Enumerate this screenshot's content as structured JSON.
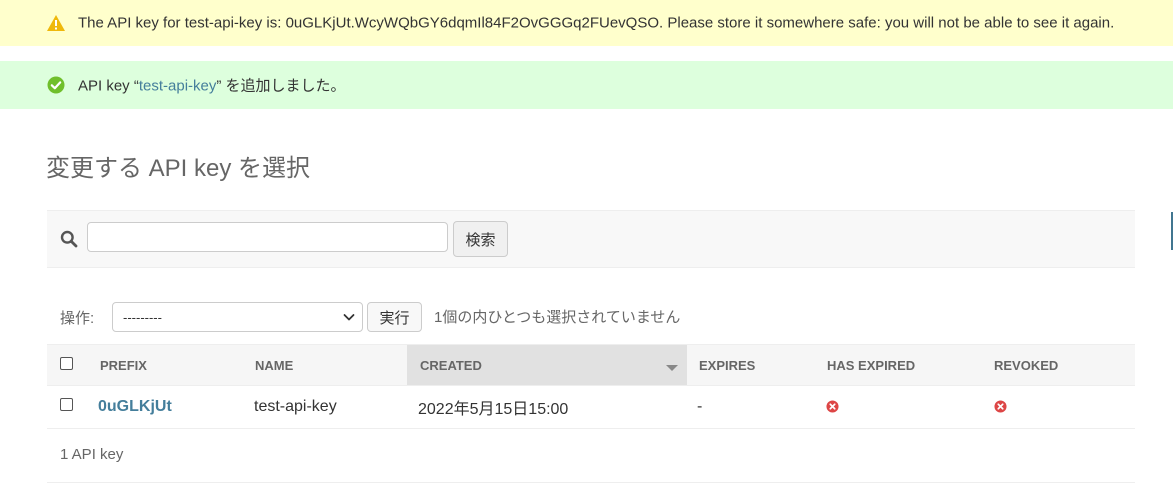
{
  "messages": {
    "warning": {
      "icon": "warning-icon",
      "text": "The API key for test-api-key is: 0uGLKjUt.WcyWQbGY6dqmIl84F2OvGGGq2FUevQSO. Please store it somewhere safe: you will not be able to see it again."
    },
    "success": {
      "icon": "check-circle-icon",
      "prefix": "API key “",
      "link": "test-api-key",
      "suffix": "” を追加しました。"
    }
  },
  "page": {
    "title": "変更する API key を選択"
  },
  "search": {
    "value": "",
    "placeholder": "",
    "button_label": "検索",
    "icon": "search-icon"
  },
  "actions": {
    "label": "操作:",
    "selected_option": "---------",
    "go_label": "実行",
    "selection_counter": "1個の内ひとつも選択されていません"
  },
  "table": {
    "columns": [
      "PREFIX",
      "NAME",
      "CREATED",
      "EXPIRES",
      "HAS EXPIRED",
      "REVOKED"
    ],
    "sorted_column": "CREATED",
    "rows": [
      {
        "prefix": "0uGLKjUt",
        "name": "test-api-key",
        "created": "2022年5月15日15:00",
        "expires": "-",
        "has_expired": "no-icon",
        "revoked": "no-icon"
      }
    ]
  },
  "paginator": {
    "text": "1 API key"
  },
  "colors": {
    "link": "#447e9b",
    "warning_bg": "#ffffcc",
    "success_bg": "#ddffdd",
    "error_icon": "#dd4646"
  }
}
